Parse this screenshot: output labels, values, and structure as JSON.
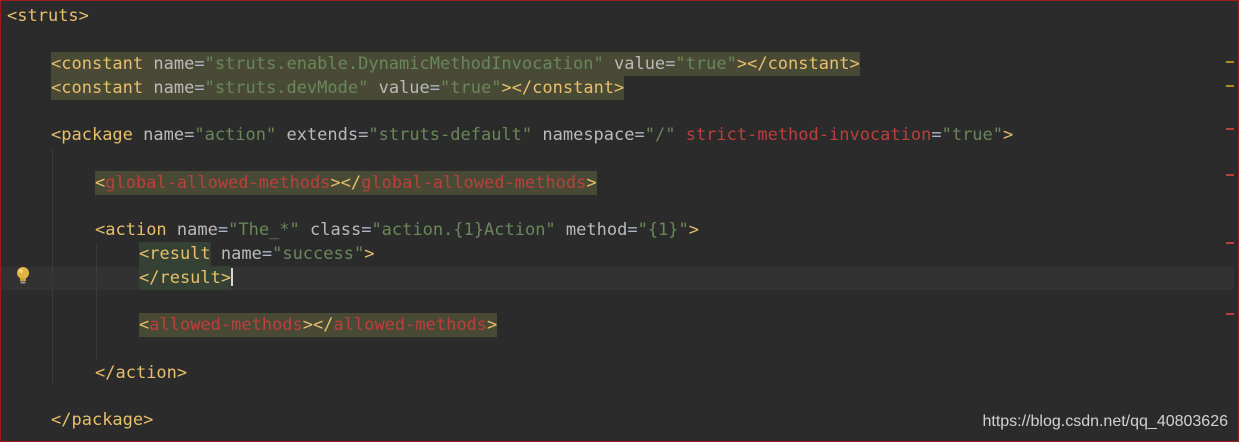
{
  "editor": {
    "colors": {
      "background": "#2b2b2b",
      "bracket": "#e8bf6a",
      "tag": "#e8bf6a",
      "attr_name": "#bababa",
      "attr_value": "#6a8759",
      "unknown": "#bc3f3c",
      "equals": "#a9b7c6",
      "match_highlight": "#494a35",
      "pair_highlight": "#344134",
      "warning_stripe": "#b78a1e",
      "error_stripe": "#bc3f3c"
    },
    "gutter_icon": "lightbulb-icon",
    "lines": [
      {
        "tokens": [
          {
            "t": "<",
            "c": "bracket"
          },
          {
            "t": "struts",
            "c": "tag"
          },
          {
            "t": ">",
            "c": "bracket"
          }
        ]
      },
      {
        "tokens": []
      },
      {
        "tokens": [
          {
            "t": "<",
            "c": "bracket",
            "h": 1
          },
          {
            "t": "constant",
            "c": "tag",
            "h": 1
          },
          {
            "t": " name",
            "c": "attr_name",
            "h": 1
          },
          {
            "t": "=",
            "c": "equals",
            "h": 1
          },
          {
            "t": "\"struts.enable.DynamicMethodInvocation\"",
            "c": "attr_value",
            "h": 1
          },
          {
            "t": " value",
            "c": "attr_name",
            "h": 1
          },
          {
            "t": "=",
            "c": "equals",
            "h": 1
          },
          {
            "t": "\"true\"",
            "c": "attr_value",
            "h": 1
          },
          {
            "t": "></",
            "c": "bracket",
            "h": 1
          },
          {
            "t": "constant",
            "c": "tag",
            "h": 1
          },
          {
            "t": ">",
            "c": "bracket",
            "h": 1
          }
        ]
      },
      {
        "tokens": [
          {
            "t": "<",
            "c": "bracket",
            "h": 1
          },
          {
            "t": "constant",
            "c": "tag",
            "h": 1
          },
          {
            "t": " name",
            "c": "attr_name",
            "h": 1
          },
          {
            "t": "=",
            "c": "equals",
            "h": 1
          },
          {
            "t": "\"struts.devMode\"",
            "c": "attr_value",
            "h": 1
          },
          {
            "t": " value",
            "c": "attr_name",
            "h": 1
          },
          {
            "t": "=",
            "c": "equals",
            "h": 1
          },
          {
            "t": "\"true\"",
            "c": "attr_value",
            "h": 1
          },
          {
            "t": "></",
            "c": "bracket",
            "h": 1
          },
          {
            "t": "constant",
            "c": "tag",
            "h": 1
          },
          {
            "t": ">",
            "c": "bracket",
            "h": 1
          }
        ]
      },
      {
        "tokens": []
      },
      {
        "tokens": [
          {
            "t": "<",
            "c": "bracket"
          },
          {
            "t": "package",
            "c": "tag"
          },
          {
            "t": " name",
            "c": "attr_name"
          },
          {
            "t": "=",
            "c": "equals"
          },
          {
            "t": "\"action\"",
            "c": "attr_value"
          },
          {
            "t": " extends",
            "c": "attr_name"
          },
          {
            "t": "=",
            "c": "equals"
          },
          {
            "t": "\"struts-default\"",
            "c": "attr_value"
          },
          {
            "t": " namespace",
            "c": "attr_name"
          },
          {
            "t": "=",
            "c": "equals"
          },
          {
            "t": "\"/\"",
            "c": "attr_value"
          },
          {
            "t": " strict-method-invocation",
            "c": "unknown"
          },
          {
            "t": "=",
            "c": "equals"
          },
          {
            "t": "\"true\"",
            "c": "attr_value"
          },
          {
            "t": ">",
            "c": "bracket"
          }
        ]
      },
      {
        "tokens": []
      },
      {
        "tokens": [
          {
            "t": "<",
            "c": "bracket",
            "h": 1
          },
          {
            "t": "global-allowed-methods",
            "c": "unknown",
            "h": 1
          },
          {
            "t": "></",
            "c": "bracket",
            "h": 1
          },
          {
            "t": "global-allowed-methods",
            "c": "unknown",
            "h": 1
          },
          {
            "t": ">",
            "c": "bracket",
            "h": 1
          }
        ]
      },
      {
        "tokens": []
      },
      {
        "tokens": [
          {
            "t": "<",
            "c": "bracket"
          },
          {
            "t": "action",
            "c": "tag"
          },
          {
            "t": " name",
            "c": "attr_name"
          },
          {
            "t": "=",
            "c": "equals"
          },
          {
            "t": "\"The_*\"",
            "c": "attr_value"
          },
          {
            "t": " class",
            "c": "attr_name"
          },
          {
            "t": "=",
            "c": "equals"
          },
          {
            "t": "\"action.{1}Action\"",
            "c": "attr_value"
          },
          {
            "t": " method",
            "c": "attr_name"
          },
          {
            "t": "=",
            "c": "equals"
          },
          {
            "t": "\"{1}\"",
            "c": "attr_value"
          },
          {
            "t": ">",
            "c": "bracket"
          }
        ]
      },
      {
        "tokens": [
          {
            "t": "<result",
            "c": "tag",
            "h": 2
          },
          {
            "t": " name",
            "c": "attr_name"
          },
          {
            "t": "=",
            "c": "equals"
          },
          {
            "t": "\"success\"",
            "c": "attr_value"
          },
          {
            "t": ">",
            "c": "bracket"
          }
        ]
      },
      {
        "tokens": [
          {
            "t": "</result>",
            "c": "tag",
            "h": 2
          }
        ],
        "cursor": true
      },
      {
        "tokens": []
      },
      {
        "tokens": [
          {
            "t": "<",
            "c": "bracket",
            "h": 1
          },
          {
            "t": "allowed-methods",
            "c": "unknown",
            "h": 1
          },
          {
            "t": "></",
            "c": "bracket",
            "h": 1
          },
          {
            "t": "allowed-methods",
            "c": "unknown",
            "h": 1
          },
          {
            "t": ">",
            "c": "bracket",
            "h": 1
          }
        ]
      },
      {
        "tokens": []
      },
      {
        "tokens": [
          {
            "t": "</",
            "c": "bracket"
          },
          {
            "t": "action",
            "c": "tag"
          },
          {
            "t": ">",
            "c": "bracket"
          }
        ]
      },
      {
        "tokens": []
      },
      {
        "tokens": [
          {
            "t": "</",
            "c": "bracket"
          },
          {
            "t": "package",
            "c": "tag"
          },
          {
            "t": ">",
            "c": "bracket"
          }
        ]
      }
    ]
  },
  "watermark": "https://blog.csdn.net/qq_40803626"
}
